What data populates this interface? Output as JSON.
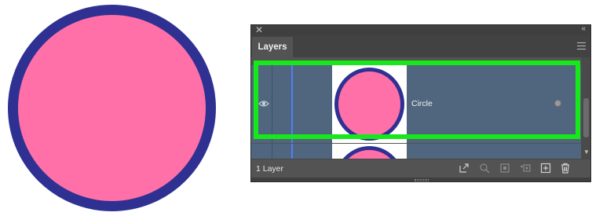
{
  "artboard": {
    "shape_icon": "circle-shape",
    "fill_color": "#ff6fa8",
    "stroke_color": "#2e3192"
  },
  "panel": {
    "close_glyph": "✕",
    "collapse_glyph": "«",
    "tab_label": "Layers",
    "menu_icon": "hamburger-menu-icon",
    "layers": [
      {
        "name": "Circle",
        "visible": true,
        "selected": true,
        "color": "#4f7cff"
      }
    ],
    "footer": {
      "layer_count": "1 Layer",
      "icons": [
        "export-icon",
        "locate-object-icon",
        "make-clipping-mask-icon",
        "create-sublayer-icon",
        "create-layer-icon",
        "delete-icon"
      ]
    }
  },
  "highlight_color": "#16e81a"
}
